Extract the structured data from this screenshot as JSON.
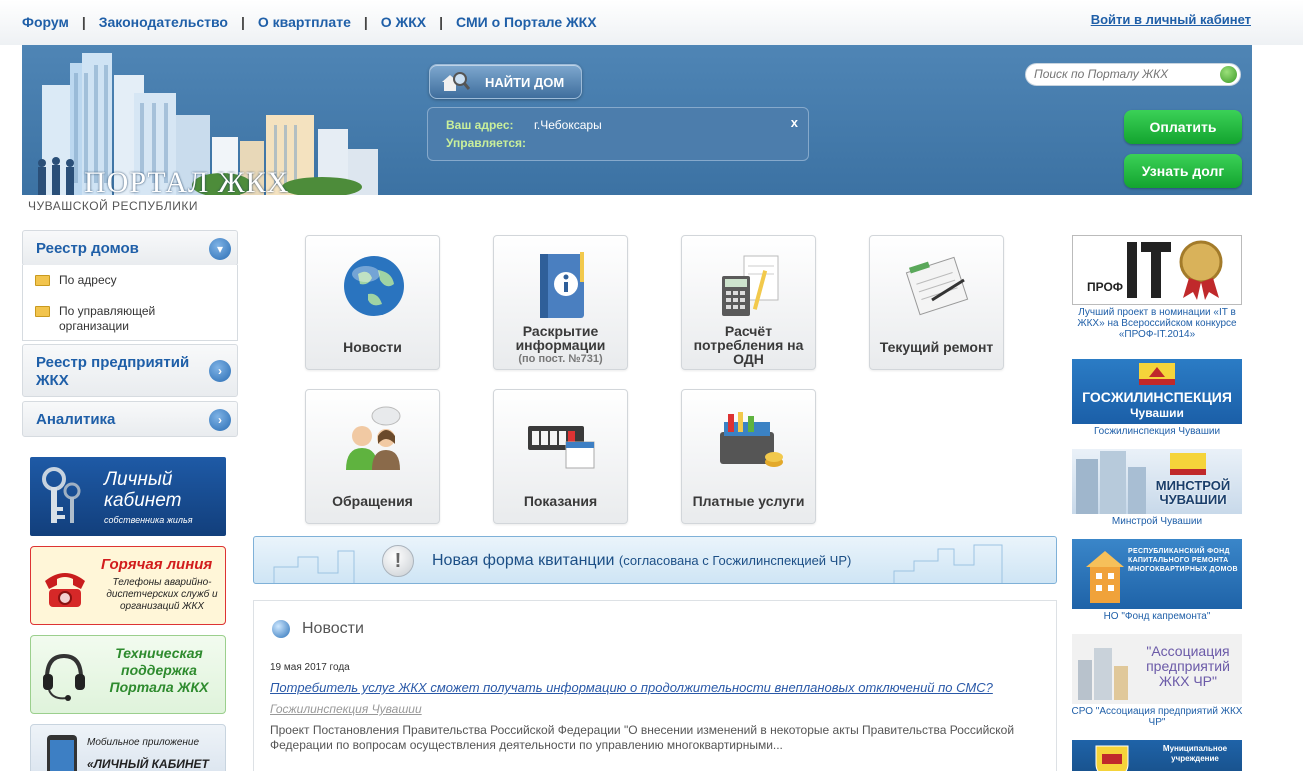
{
  "topnav": {
    "links": [
      "Форум",
      "Законодательство",
      "О квартплате",
      "О ЖКХ",
      "СМИ о Портале ЖКХ"
    ],
    "cabinet_link": "Войти в личный кабинет"
  },
  "banner": {
    "logo_text": "ПОРТАЛ ЖКХ",
    "region": "ЧУВАШСКОЙ РЕСПУБЛИКИ",
    "find_button": "НАЙТИ ДОМ",
    "address_label": "Ваш адрес:",
    "address_value": "г.Чебоксары",
    "managed_label": "Управляется:",
    "managed_value": "",
    "close": "x",
    "search_placeholder": "Поиск по Порталу ЖКХ",
    "pay_button": "Оплатить",
    "debt_button": "Узнать долг"
  },
  "sidebar": {
    "registry_houses": "Реестр домов",
    "sub_items": [
      "По адресу",
      "По управляющей организации"
    ],
    "registry_companies": "Реестр предприятий ЖКХ",
    "analytics": "Аналитика",
    "promo_lk_title": "Личный кабинет",
    "promo_lk_sub": "собственника жилья",
    "promo_hot_title": "Горячая линия",
    "promo_hot_sub": "Телефоны аварийно-диспетчерских служб и организаций ЖКХ",
    "promo_tech_title": "Техническая поддержка Портала ЖКХ",
    "promo_mob_sub": "Мобильное приложение",
    "promo_mob_title": "«ЛИЧНЫЙ КАБИНЕТ"
  },
  "tiles": [
    {
      "label": "Новости",
      "sub": "",
      "icon": "globe-icon"
    },
    {
      "label": "Раскрытие информации",
      "sub": "(по пост. №731)",
      "icon": "info-book-icon"
    },
    {
      "label": "Расчёт потребления на ОДН",
      "sub": "",
      "icon": "calculator-icon"
    },
    {
      "label": "Текущий ремонт",
      "sub": "",
      "icon": "notepad-icon"
    },
    {
      "label": "Обращения",
      "sub": "",
      "icon": "people-chat-icon"
    },
    {
      "label": "Показания",
      "sub": "",
      "icon": "meter-icon"
    },
    {
      "label": "Платные услуги",
      "sub": "",
      "icon": "toolbox-icon"
    }
  ],
  "notice": {
    "text": "Новая форма квитанции",
    "note": "(согласована с Госжилинспекцией ЧР)"
  },
  "news": {
    "header": "Новости",
    "date": "19 мая 2017 года",
    "link": "Потребитель услуг ЖКХ сможет получать информацию о продолжительности внеплановых отключений по СМС?",
    "source": "Госжилинспекция Чувашии",
    "body": "Проект Постановления Правительства Российской Федерации \"О внесении изменений в некоторые акты Правительства Российской Федерации по вопросам осуществления деятельности по управлению многоквартирными..."
  },
  "right": {
    "prof_logo": "ПРОФ IT",
    "prof_caption": "Лучший проект в номинации «IT в ЖКХ» на Всероссийском конкурсе «ПРОФ-IT.2014»",
    "gji_banner": "ГОСЖИЛИНСПЕКЦИЯ",
    "gji_banner_sub": "Чувашии",
    "gji_caption": "Госжилинспекция Чувашии",
    "minstroy_banner": "МИНСТРОЙ ЧУВАШИИ",
    "minstroy_caption": "Минстрой Чувашии",
    "fond_banner": "РЕСПУБЛИКАНСКИЙ ФОНД КАПИТАЛЬНОГО РЕМОНТА МНОГОКВАРТИРНЫХ ДОМОВ",
    "fond_caption": "НО \"Фонд капремонта\"",
    "assoc_banner": "\"Ассоциация предприятий ЖКХ ЧР\"",
    "assoc_caption": "СРО \"Ассоциация предприятий ЖКХ ЧР\"",
    "muni_banner": "Муниципальное учреждение"
  }
}
